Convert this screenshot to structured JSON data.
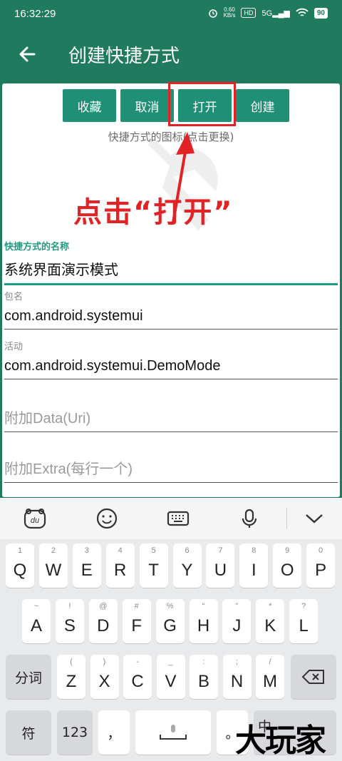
{
  "status": {
    "time": "16:32:29",
    "speed_top": "0.60",
    "speed_bot": "KB/s",
    "hd": "HD",
    "net": "5G",
    "battery": "90"
  },
  "appbar": {
    "title": "创建快捷方式"
  },
  "actions": {
    "favorite": "收藏",
    "cancel": "取消",
    "open": "打开",
    "create": "创建"
  },
  "icon_hint": "快捷方式的图标(点击更换)",
  "annotation": "点击“打开”",
  "fields": {
    "name_label": "快捷方式的名称",
    "name_value": "系统界面演示模式",
    "package_label": "包名",
    "package_value": "com.android.systemui",
    "activity_label": "活动",
    "activity_value": "com.android.systemui.DemoMode",
    "data_placeholder": "附加Data(Uri)",
    "extra_placeholder": "附加Extra(每行一个)"
  },
  "keyboard": {
    "row1": [
      [
        "1",
        "Q"
      ],
      [
        "2",
        "W"
      ],
      [
        "3",
        "E"
      ],
      [
        "4",
        "R"
      ],
      [
        "5",
        "T"
      ],
      [
        "6",
        "Y"
      ],
      [
        "7",
        "U"
      ],
      [
        "8",
        "I"
      ],
      [
        "9",
        "O"
      ],
      [
        "0",
        "P"
      ]
    ],
    "row2": [
      [
        "~",
        "A"
      ],
      [
        "!",
        "S"
      ],
      [
        "@",
        "D"
      ],
      [
        "#",
        "F"
      ],
      [
        "%",
        "G"
      ],
      [
        "“",
        "H"
      ],
      [
        "”",
        "J"
      ],
      [
        "*",
        "K"
      ],
      [
        "?",
        "L"
      ]
    ],
    "row3": [
      [
        "(",
        "Z"
      ],
      [
        ")",
        "X"
      ],
      [
        "-",
        "C"
      ],
      [
        "_",
        "V"
      ],
      [
        ":",
        "B"
      ],
      [
        ";",
        "N"
      ],
      [
        "/",
        "M"
      ]
    ],
    "segment": "分词",
    "symbol": "符",
    "num": "123",
    "comma": "，",
    "period": "。",
    "lang": "中",
    "watermark": "大玩家"
  }
}
